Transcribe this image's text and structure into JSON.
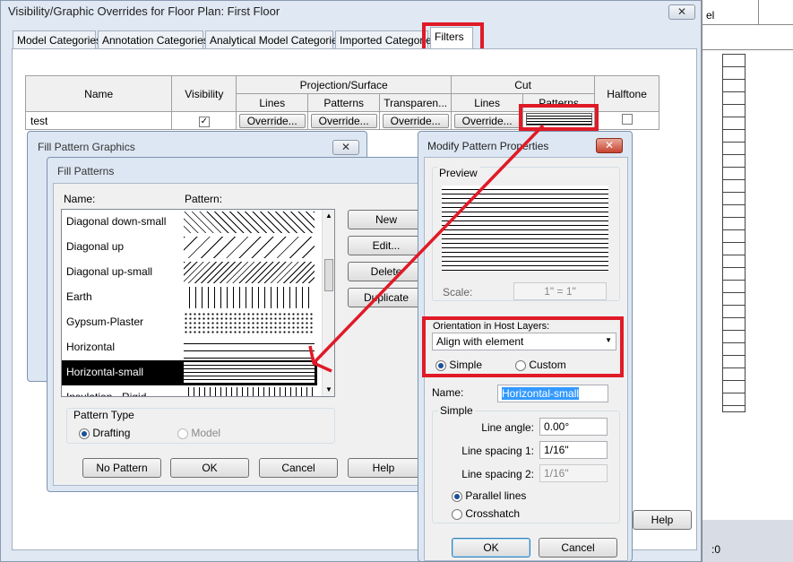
{
  "vg_dialog": {
    "title": "Visibility/Graphic Overrides for Floor Plan: First Floor",
    "close": "✕",
    "tabs": [
      "Model Categories",
      "Annotation Categories",
      "Analytical Model Categories",
      "Imported Categories",
      "Filters"
    ],
    "active_tab": "Filters",
    "table": {
      "headers": {
        "name": "Name",
        "visibility": "Visibility",
        "projection": "Projection/Surface",
        "cut": "Cut",
        "halftone": "Halftone",
        "lines": "Lines",
        "patterns": "Patterns",
        "transparency": "Transparen..."
      },
      "row": {
        "name": "test",
        "visibility_checked": true,
        "override": "Override...",
        "halftone_checked": false
      }
    },
    "help_button": "Help"
  },
  "background_window": {
    "fragment": "el",
    "status": ":0"
  },
  "fill_pattern_graphics": {
    "title": "Fill Pattern Graphics",
    "close": "✕"
  },
  "fill_patterns": {
    "title": "Fill Patterns",
    "col_name": "Name:",
    "col_pattern": "Pattern:",
    "items": [
      {
        "name": "Diagonal down-small",
        "pattern": "diag-down"
      },
      {
        "name": "Diagonal up",
        "pattern": "diag-up"
      },
      {
        "name": "Diagonal up-small",
        "pattern": "diag-up-small"
      },
      {
        "name": "Earth",
        "pattern": "earth"
      },
      {
        "name": "Gypsum-Plaster",
        "pattern": "dots"
      },
      {
        "name": "Horizontal",
        "pattern": "horizontal"
      },
      {
        "name": "Horizontal-small",
        "pattern": "horizontal-small",
        "selected": true
      },
      {
        "name": "Insulation - Rigid",
        "pattern": "grid"
      }
    ],
    "buttons": {
      "new": "New",
      "edit": "Edit...",
      "delete": "Delete",
      "duplicate": "Duplicate"
    },
    "pattern_type": {
      "label": "Pattern Type",
      "drafting": "Drafting",
      "model": "Model",
      "selected": "Drafting"
    },
    "footer": {
      "no_pattern": "No Pattern",
      "ok": "OK",
      "cancel": "Cancel",
      "help": "Help"
    }
  },
  "modify_pattern": {
    "title": "Modify Pattern Properties",
    "close": "✕",
    "preview_label": "Preview",
    "scale_label": "Scale:",
    "scale_value": "1\" = 1\"",
    "orientation_label": "Orientation in Host Layers:",
    "orientation_value": "Align with element",
    "simple_label": "Simple",
    "custom_label": "Custom",
    "simple_selected": true,
    "name_label": "Name:",
    "name_value": "Horizontal-small",
    "group_label": "Simple",
    "line_angle_label": "Line angle:",
    "line_angle_value": "0.00°",
    "spacing1_label": "Line spacing 1:",
    "spacing1_value": "1/16\"",
    "spacing2_label": "Line spacing 2:",
    "spacing2_value": "1/16\"",
    "parallel_label": "Parallel lines",
    "crosshatch_label": "Crosshatch",
    "ok": "OK",
    "cancel": "Cancel"
  },
  "colors": {
    "annotation_red": "#e01a27",
    "selection": "#000000",
    "name_highlight": "#3399ff"
  }
}
